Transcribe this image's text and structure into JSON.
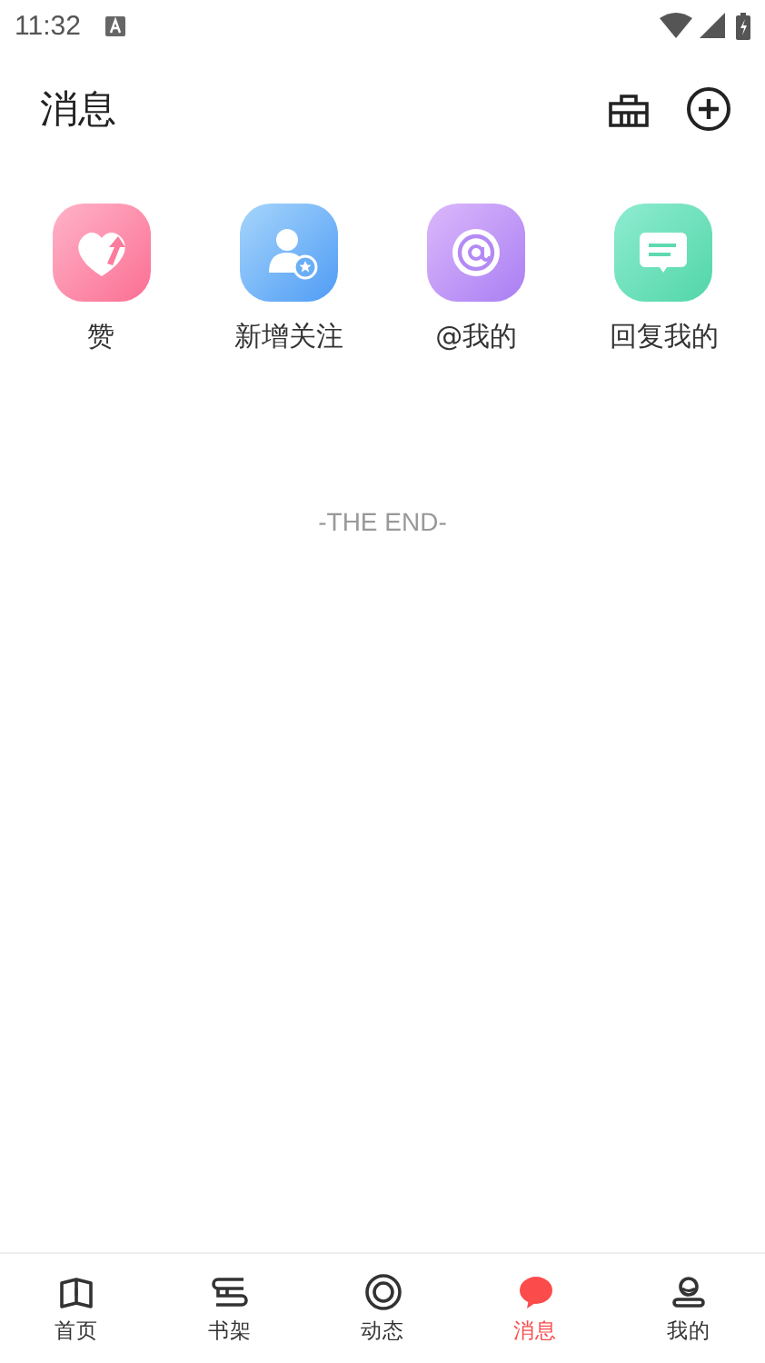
{
  "status_bar": {
    "time": "11:32"
  },
  "header": {
    "title": "消息"
  },
  "shortcuts": [
    {
      "kind": "likes",
      "label": "赞"
    },
    {
      "kind": "follow",
      "label": "新增关注"
    },
    {
      "kind": "mention",
      "label": "@我的"
    },
    {
      "kind": "reply",
      "label": "回复我的"
    }
  ],
  "end_text": "-THE END-",
  "tabs": [
    {
      "kind": "home",
      "label": "首页",
      "selected": false
    },
    {
      "kind": "shelf",
      "label": "书架",
      "selected": false
    },
    {
      "kind": "feed",
      "label": "动态",
      "selected": false
    },
    {
      "kind": "messages",
      "label": "消息",
      "selected": true
    },
    {
      "kind": "profile",
      "label": "我的",
      "selected": false
    }
  ]
}
